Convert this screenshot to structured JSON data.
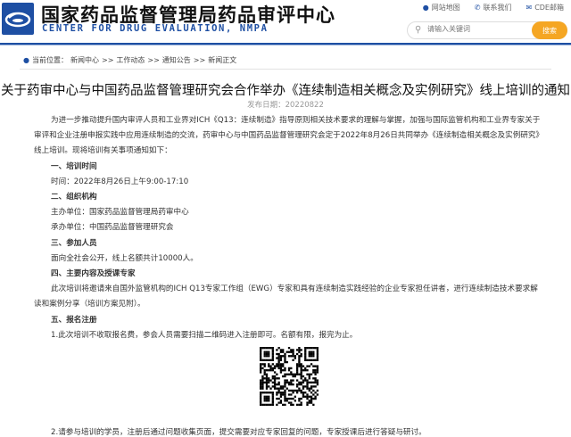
{
  "header": {
    "site_title": "国家药品监督管理局药品审评中心",
    "site_subtitle": "CENTER FOR DRUG EVALUATION, NMPA",
    "links": [
      "网站地图",
      "联系我们",
      "CDE邮箱"
    ],
    "search_placeholder": "请输入关键词",
    "search_button": "搜索"
  },
  "breadcrumb": {
    "label": "当前位置：",
    "items": [
      "新闻中心",
      ">>",
      "工作动态",
      ">>",
      "通知公告",
      ">>",
      "新闻正文"
    ]
  },
  "article": {
    "title": "关于药审中心与中国药品监督管理研究会合作举办《连续制造相关概念及实例研究》线上培训的通知",
    "date": "发布日期：20220822",
    "intro": "为进一步推动提升国内审评人员和工业界对ICH《Q13：连续制造》指导原则相关技术要求的理解与掌握，加强与国际监管机构和工业界专家关于审评和企业注册申报实践中应用连续制造的交流，药审中心与中国药品监督管理研究会定于2022年8月26日共同举办《连续制造相关概念及实例研究》线上培训。现将培训有关事项通知如下：",
    "h1": "一、培训时间",
    "p1": "时间：2022年8月26日上午9:00-17:10",
    "h2": "二、组织机构",
    "p2a": "主办单位：国家药品监督管理局药审中心",
    "p2b": "承办单位：中国药品监督管理研究会",
    "h3": "三、参加人员",
    "p3": "面向全社会公开，线上名额共计10000人。",
    "h4": "四、主要内容及授课专家",
    "p4": "此次培训将邀请来自国外监管机构的ICH Q13专家工作组（EWG）专家和具有连续制造实践经验的企业专家担任讲者，进行连续制造技术要求解读和案例分享（培训方案见附）。",
    "h5": "五、报名注册",
    "p5": "1.此次培训不收取报名费，参会人员需要扫描二维码进入注册即可。名额有限，报完为止。",
    "p6": "2.请参与培训的学员，注册后通过问题收集页面，提交需要对应专家回复的问题，专家授课后进行答疑与研讨。"
  },
  "colors": {
    "brand": "#1e4fa3",
    "search_button": "#f5a623"
  }
}
